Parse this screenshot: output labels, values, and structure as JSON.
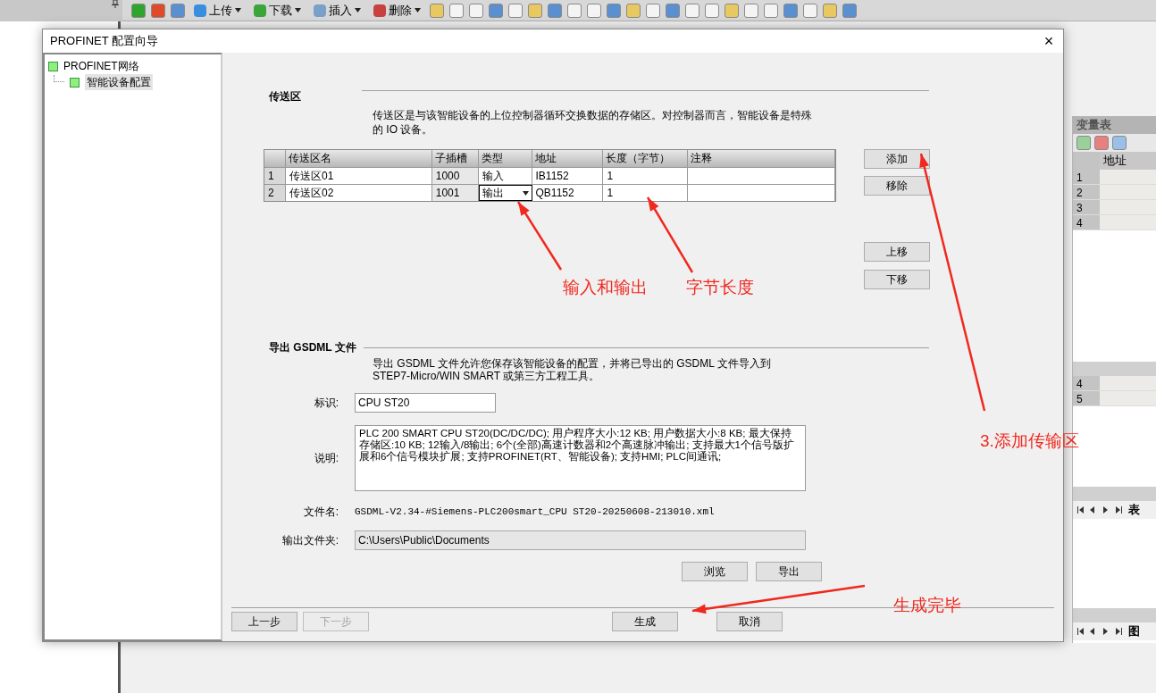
{
  "toolbar": {
    "buttons": [
      {
        "label": "上传",
        "kind": "dropdown"
      },
      {
        "label": "下载",
        "kind": "dropdown"
      },
      {
        "label": "插入",
        "kind": "dropdown"
      },
      {
        "label": "删除",
        "kind": "dropdown"
      }
    ]
  },
  "dialog": {
    "title": "PROFINET 配置向导",
    "close": "×",
    "tree": [
      {
        "label": "PROFINET网络",
        "selected": false,
        "children": [
          {
            "label": "智能设备配置",
            "selected": true
          }
        ]
      }
    ],
    "transfer": {
      "heading": "传送区",
      "description": "传送区是与该智能设备的上位控制器循环交换数据的存储区。对控制器而言，智能设备是特殊的 IO 设备。",
      "columns": [
        "传送区名",
        "子插槽",
        "类型",
        "地址",
        "长度（字节）",
        "注释"
      ],
      "rows": [
        {
          "index": "1",
          "name": "传送区01",
          "slot": "1000",
          "type": "输入",
          "editing": false,
          "address": "IB1152",
          "length": "1"
        },
        {
          "index": "2",
          "name": "传送区02",
          "slot": "1001",
          "type": "输出",
          "editing": true,
          "address": "QB1152",
          "length": "1"
        }
      ],
      "buttons": [
        "添加",
        "移除",
        "上移",
        "下移"
      ]
    },
    "export": {
      "heading": "导出 GSDML 文件",
      "description": "导出 GSDML 文件允许您保存该智能设备的配置，并将已导出的 GSDML 文件导入到 STEP7-Micro/WIN SMART 或第三方工程工具。",
      "id_label": "标识:",
      "id_value": "CPU ST20",
      "desc_label": "说明:",
      "desc_value": "PLC 200 SMART CPU ST20(DC/DC/DC); 用户程序大小:12 KB; 用户数据大小:8 KB; 最大保持存储区:10 KB; 12输入/8输出; 6个(全部)高速计数器和2个高速脉冲输出; 支持最大1个信号版扩展和6个信号模块扩展; 支持PROFINET(RT、智能设备); 支持HMI; PLC间通讯;",
      "file_label": "文件名:",
      "file_value": "GSDML-V2.34-#Siemens-PLC200smart_CPU ST20-20250608-213010.xml",
      "folder_label": "输出文件夹:",
      "folder_value": "C:\\Users\\Public\\Documents",
      "buttons": [
        "浏览",
        "导出"
      ]
    },
    "footer": [
      {
        "label": "上一步",
        "disabled": false
      },
      {
        "label": "下一步",
        "disabled": true
      },
      {
        "label": "生成",
        "disabled": false
      },
      {
        "label": "取消",
        "disabled": false
      }
    ]
  },
  "side_panel": {
    "title": "变量表",
    "column": "地址",
    "rows": [
      "1",
      "2",
      "3",
      "4"
    ],
    "lower_rows": [
      "4",
      "5"
    ],
    "tab": "表",
    "bottom_tab": "图"
  },
  "annotations": [
    {
      "text": "输入和输出"
    },
    {
      "text": "字节长度"
    },
    {
      "text": "3.添加传输区"
    },
    {
      "text": "生成完毕"
    }
  ]
}
